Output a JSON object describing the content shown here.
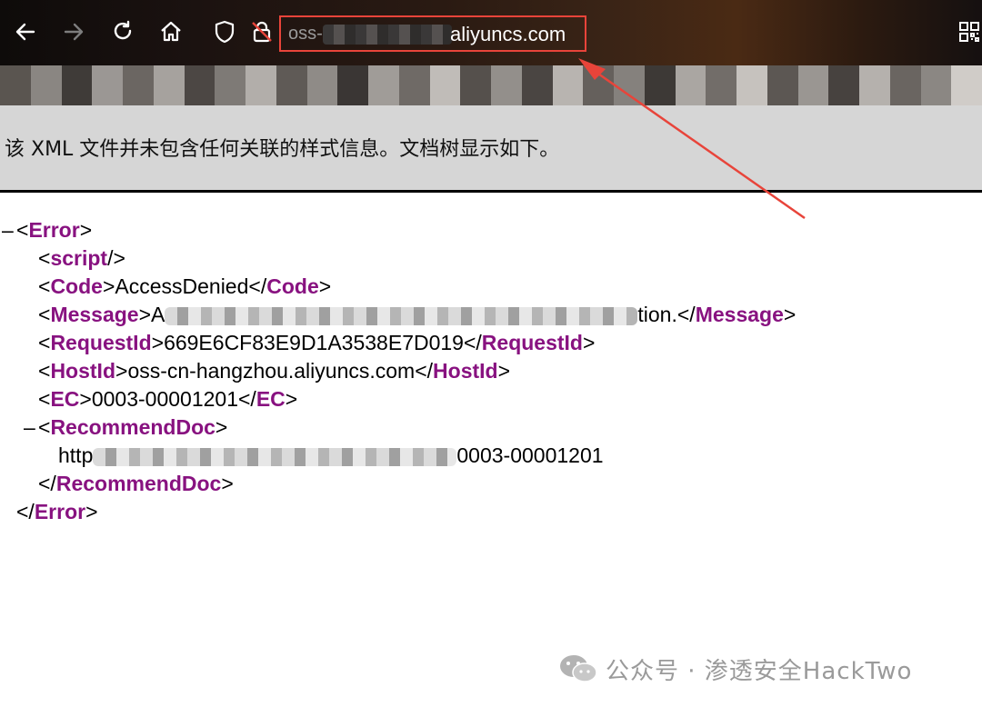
{
  "browser": {
    "url_prefix": "oss-",
    "url_host": "aliyuncs.com"
  },
  "notice": {
    "text": "该 XML 文件并未包含任何关联的样式信息。文档树显示如下。"
  },
  "xml": {
    "error_tag": "Error",
    "script_tag": "script",
    "code_tag": "Code",
    "code_value": "AccessDenied",
    "message_tag": "Message",
    "message_start": "A",
    "message_end": "tion.",
    "requestid_tag": "RequestId",
    "requestid_value": "669E6CF83E9D1A3538E7D019",
    "hostid_tag": "HostId",
    "hostid_value": "oss-cn-hangzhou.aliyuncs.com",
    "ec_tag": "EC",
    "ec_value": "0003-00001201",
    "recommend_tag": "RecommendDoc",
    "recommend_start": "http",
    "recommend_end": "0003-00001201"
  },
  "watermark": {
    "text": "公众号 · 渗透安全HackTwo"
  },
  "colors": {
    "tag": "#881280",
    "highlight_box": "#e8443a"
  }
}
